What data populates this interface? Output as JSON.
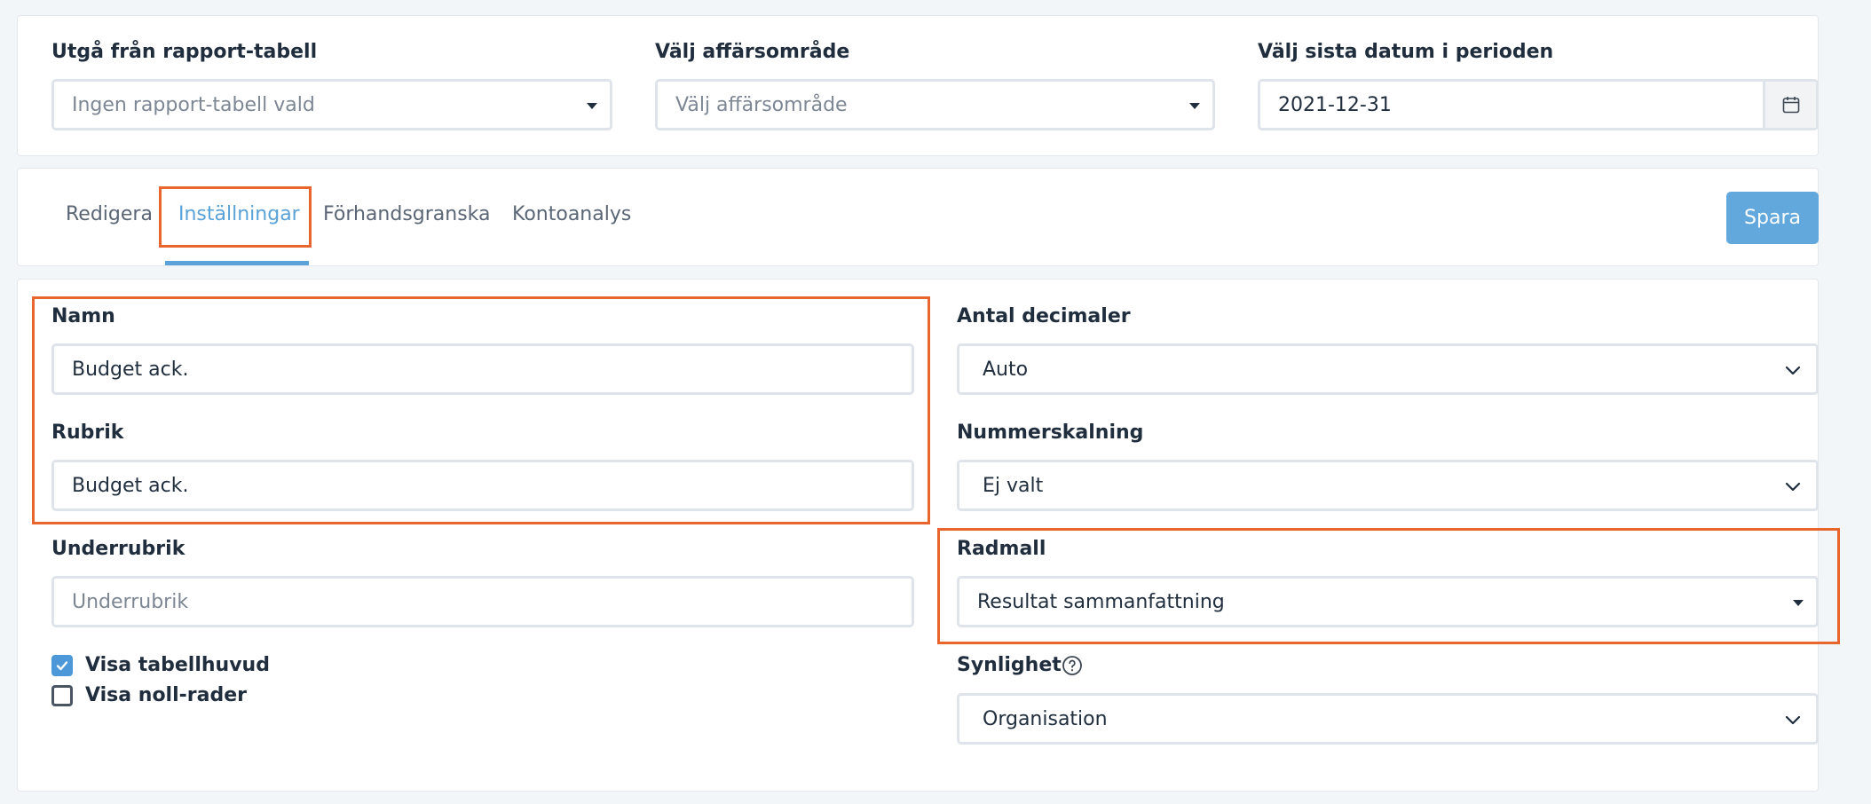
{
  "filters": {
    "report_table": {
      "label": "Utgå från rapport-tabell",
      "value": "Ingen rapport-tabell vald"
    },
    "business_area": {
      "label": "Välj affärsområde",
      "value": "Välj affärsområde"
    },
    "end_date": {
      "label": "Välj sista datum i perioden",
      "value": "2021-12-31"
    }
  },
  "tabs": [
    {
      "label": "Redigera",
      "active": false
    },
    {
      "label": "Inställningar",
      "active": true
    },
    {
      "label": "Förhandsgranska",
      "active": false
    },
    {
      "label": "Kontoanalys",
      "active": false
    }
  ],
  "save_label": "Spara",
  "form": {
    "name": {
      "label": "Namn",
      "value": "Budget ack."
    },
    "heading": {
      "label": "Rubrik",
      "value": "Budget ack."
    },
    "subheading": {
      "label": "Underrubrik",
      "placeholder": "Underrubrik",
      "value": ""
    },
    "show_header": {
      "label": "Visa tabellhuvud",
      "checked": true
    },
    "show_zero_rows": {
      "label": "Visa noll-rader",
      "checked": false
    },
    "decimals": {
      "label": "Antal decimaler",
      "value": "Auto"
    },
    "number_scaling": {
      "label": "Nummerskalning",
      "value": "Ej valt"
    },
    "row_template": {
      "label": "Radmall",
      "value": "Resultat sammanfattning"
    },
    "visibility": {
      "label": "Synlighet",
      "value": "Organisation"
    }
  },
  "colors": {
    "accent": "#5aa2d8",
    "highlight": "#e8652e",
    "save_button": "#62a8dc"
  }
}
